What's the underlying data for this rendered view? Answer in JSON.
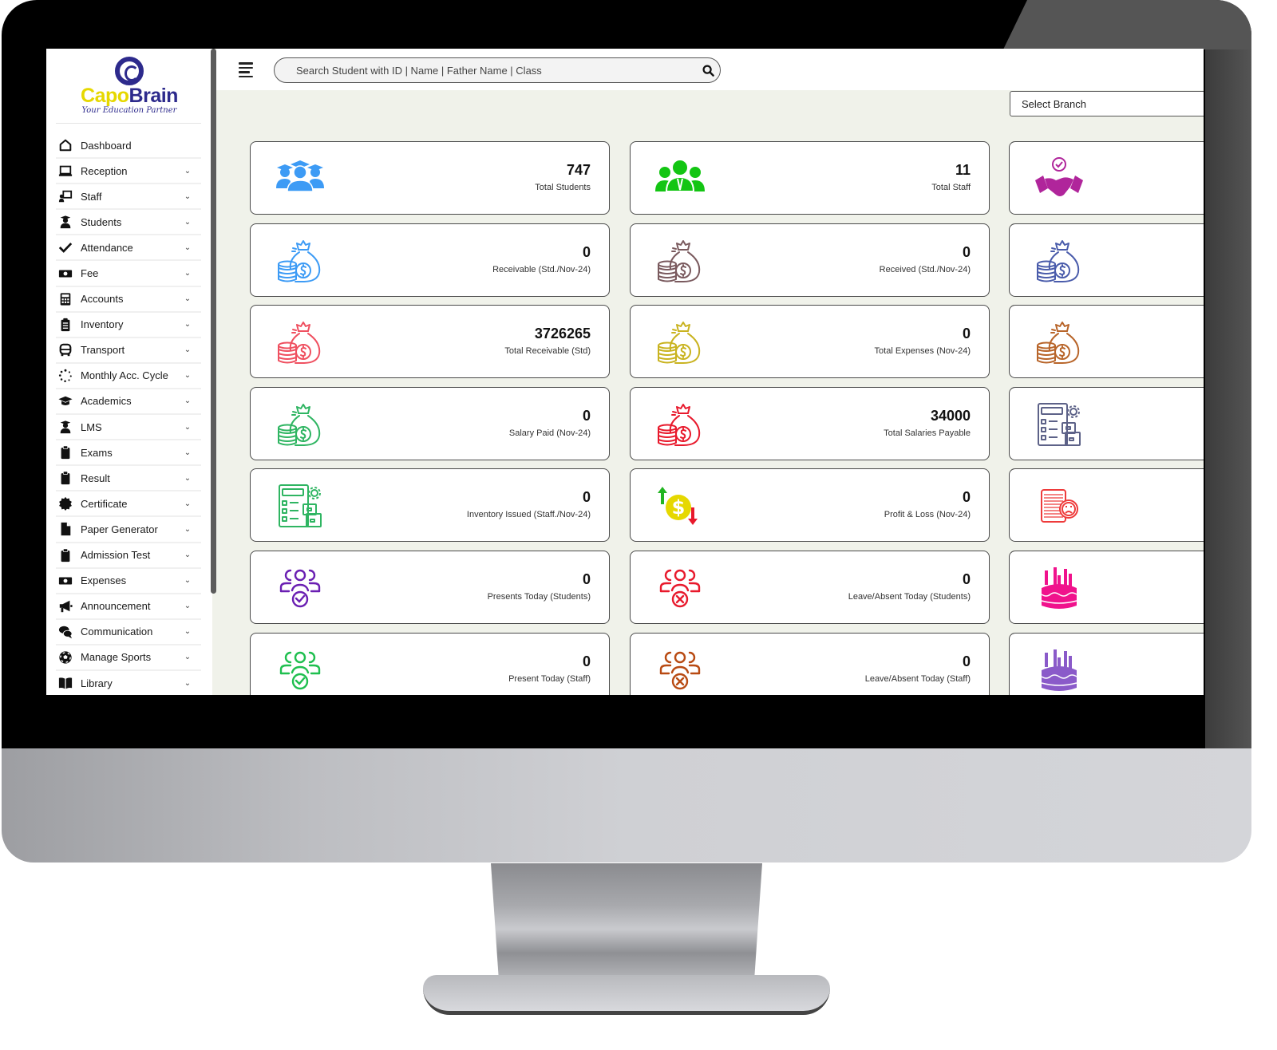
{
  "app": {
    "brand_first": "Capo",
    "brand_second": "Brain",
    "tagline": "Your Education Partner"
  },
  "colors": {
    "brand_yellow": "#e6d800",
    "brand_navy": "#2d2a8c",
    "page_background": "#f0f2ea"
  },
  "sidebar": {
    "items": [
      {
        "label": "Dashboard",
        "icon": "home-icon",
        "has_submenu": false
      },
      {
        "label": "Reception",
        "icon": "laptop-icon",
        "has_submenu": true
      },
      {
        "label": "Staff",
        "icon": "chalkboard-teacher-icon",
        "has_submenu": true
      },
      {
        "label": "Students",
        "icon": "user-graduate-icon",
        "has_submenu": true
      },
      {
        "label": "Attendance",
        "icon": "check-icon",
        "has_submenu": true
      },
      {
        "label": "Fee",
        "icon": "money-bill-icon",
        "has_submenu": true
      },
      {
        "label": "Accounts",
        "icon": "calculator-icon",
        "has_submenu": true
      },
      {
        "label": "Inventory",
        "icon": "clipboard-list-icon",
        "has_submenu": true
      },
      {
        "label": "Transport",
        "icon": "bus-icon",
        "has_submenu": true
      },
      {
        "label": "Monthly Acc. Cycle",
        "icon": "spinner-icon",
        "has_submenu": true
      },
      {
        "label": "Academics",
        "icon": "graduation-cap-icon",
        "has_submenu": true
      },
      {
        "label": "LMS",
        "icon": "user-graduate-icon",
        "has_submenu": true
      },
      {
        "label": "Exams",
        "icon": "clipboard-icon",
        "has_submenu": true
      },
      {
        "label": "Result",
        "icon": "clipboard-icon",
        "has_submenu": true
      },
      {
        "label": "Certificate",
        "icon": "certificate-icon",
        "has_submenu": true
      },
      {
        "label": "Paper Generator",
        "icon": "file-icon",
        "has_submenu": true
      },
      {
        "label": "Admission Test",
        "icon": "clipboard-icon",
        "has_submenu": true
      },
      {
        "label": "Expenses",
        "icon": "money-bill-icon",
        "has_submenu": true
      },
      {
        "label": "Announcement",
        "icon": "bullhorn-icon",
        "has_submenu": true
      },
      {
        "label": "Communication",
        "icon": "comments-icon",
        "has_submenu": true
      },
      {
        "label": "Manage Sports",
        "icon": "futbol-icon",
        "has_submenu": true
      },
      {
        "label": "Library",
        "icon": "book-icon",
        "has_submenu": true
      }
    ],
    "chevron": "⌄"
  },
  "topbar": {
    "search_placeholder": "Search Student with ID | Name | Father Name | Class",
    "search_value": "",
    "branch_select": "Select Branch"
  },
  "cards": [
    {
      "value": "747",
      "label": "Total Students",
      "icon": "students-icon",
      "color": "#3d9bf5"
    },
    {
      "value": "11",
      "label": "Total Staff",
      "icon": "staff-icon",
      "color": "#13c513"
    },
    {
      "value": "",
      "label": "",
      "icon": "handshake-check-icon",
      "color": "#b0259b"
    },
    {
      "value": "0",
      "label": "Receivable (Std./Nov-24)",
      "icon": "money-bag-icon",
      "color": "#3d9bf5"
    },
    {
      "value": "0",
      "label": "Received (Std./Nov-24)",
      "icon": "money-bag-icon",
      "color": "#7a5a5e"
    },
    {
      "value": "",
      "label": "",
      "icon": "money-bag-icon",
      "color": "#4a5cab"
    },
    {
      "value": "3726265",
      "label": "Total Receivable (Std)",
      "icon": "money-bag-icon",
      "color": "#ef5060"
    },
    {
      "value": "0",
      "label": "Total Expenses (Nov-24)",
      "icon": "money-bag-icon",
      "color": "#c9b320"
    },
    {
      "value": "",
      "label": "",
      "icon": "money-bag-icon",
      "color": "#b8652a"
    },
    {
      "value": "0",
      "label": "Salary Paid (Nov-24)",
      "icon": "money-bag-icon",
      "color": "#2fb562"
    },
    {
      "value": "34000",
      "label": "Total Salaries Payable",
      "icon": "money-bag-icon",
      "color": "#e8192c"
    },
    {
      "value": "",
      "label": "",
      "icon": "inventory-checklist-icon",
      "color": "#5d6288"
    },
    {
      "value": "0",
      "label": "Inventory Issued (Staff./Nov-24)",
      "icon": "inventory-checklist-icon",
      "color": "#2fb562"
    },
    {
      "value": "0",
      "label": "Profit & Loss (Nov-24)",
      "icon": "profit-loss-icon",
      "color": "#e6d800"
    },
    {
      "value": "",
      "label": "",
      "icon": "complaint-icon",
      "color": "#ee3b3b"
    },
    {
      "value": "0",
      "label": "Presents Today (Students)",
      "icon": "group-check-icon",
      "color": "#6a1fb2"
    },
    {
      "value": "0",
      "label": "Leave/Absent Today (Students)",
      "icon": "group-cross-icon",
      "color": "#e8192c"
    },
    {
      "value": "",
      "label": "",
      "icon": "birthday-cake-icon",
      "color": "#f0128c"
    },
    {
      "value": "0",
      "label": "Present Today (Staff)",
      "icon": "group-check-icon",
      "color": "#1fbf4f"
    },
    {
      "value": "0",
      "label": "Leave/Absent Today (Staff)",
      "icon": "group-cross-icon",
      "color": "#b84a12"
    },
    {
      "value": "",
      "label": "",
      "icon": "birthday-cake-icon",
      "color": "#8a5ac9"
    }
  ]
}
